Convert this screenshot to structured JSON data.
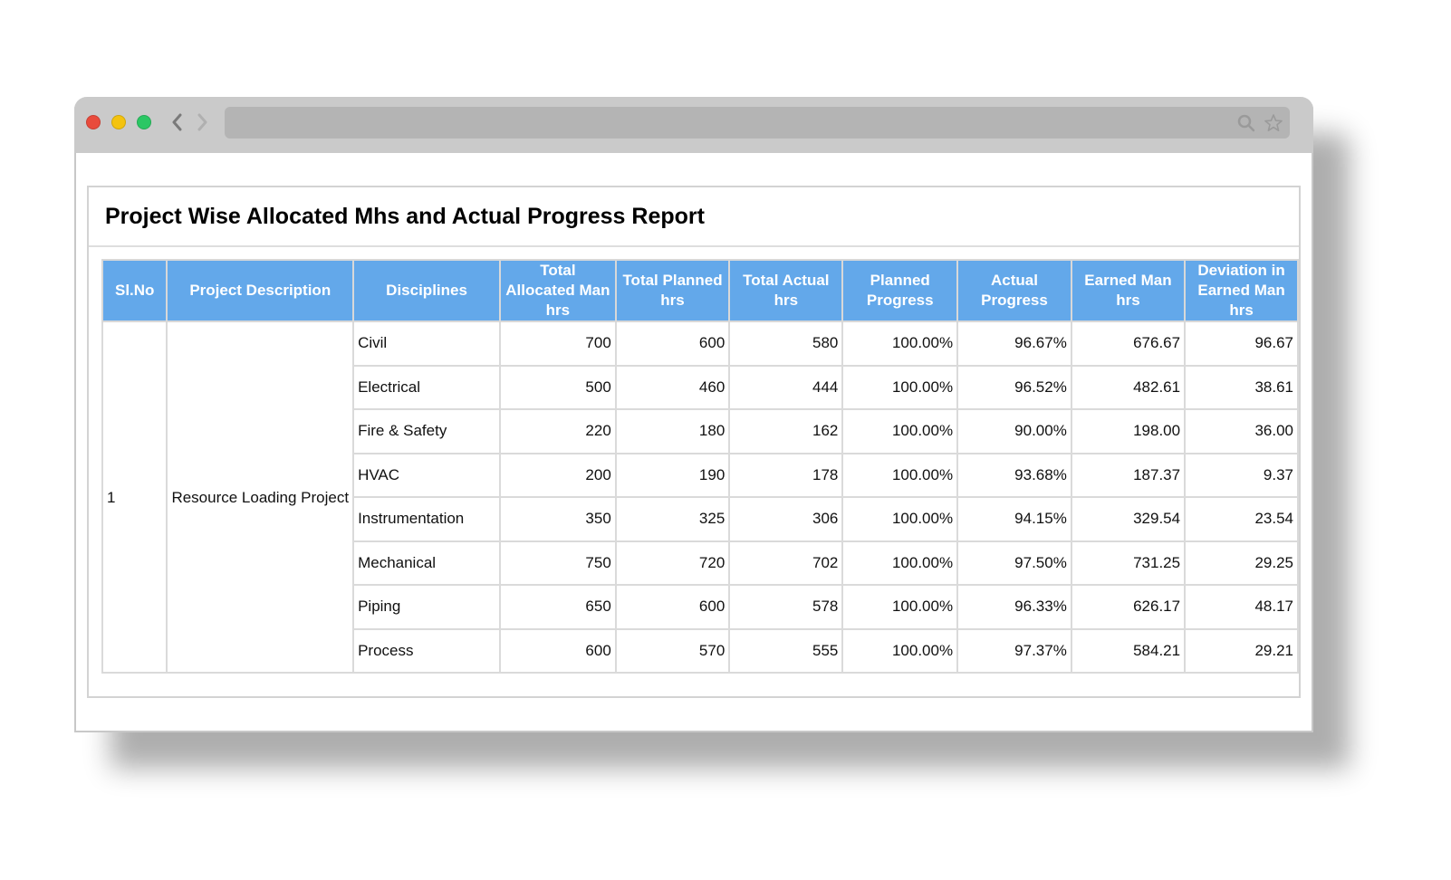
{
  "browser": {
    "url": "",
    "icons": {
      "back": "chevron-left-icon",
      "forward": "chevron-right-icon",
      "search": "search-icon",
      "bookmark": "star-icon"
    },
    "colors": {
      "close": "#e94b3c",
      "minimize": "#f4c30f",
      "maximize": "#2bc764"
    }
  },
  "report": {
    "title": "Project Wise Allocated Mhs and Actual Progress Report",
    "header_color": "#63a8ea",
    "columns": [
      "Sl.No",
      "Project Description",
      "Disciplines",
      "Total Allocated Man hrs",
      "Total Planned hrs",
      "Total Actual hrs",
      "Planned Progress",
      "Actual Progress",
      "Earned Man hrs",
      "Deviation in Earned Man hrs"
    ],
    "project": {
      "sl_no": "1",
      "description": "Resource Loading Project"
    },
    "rows": [
      {
        "discipline": "Civil",
        "allocated": "700",
        "planned": "600",
        "actual": "580",
        "planned_progress": "100.00%",
        "actual_progress": "96.67%",
        "earned": "676.67",
        "deviation": "96.67"
      },
      {
        "discipline": "Electrical",
        "allocated": "500",
        "planned": "460",
        "actual": "444",
        "planned_progress": "100.00%",
        "actual_progress": "96.52%",
        "earned": "482.61",
        "deviation": "38.61"
      },
      {
        "discipline": "Fire & Safety",
        "allocated": "220",
        "planned": "180",
        "actual": "162",
        "planned_progress": "100.00%",
        "actual_progress": "90.00%",
        "earned": "198.00",
        "deviation": "36.00"
      },
      {
        "discipline": "HVAC",
        "allocated": "200",
        "planned": "190",
        "actual": "178",
        "planned_progress": "100.00%",
        "actual_progress": "93.68%",
        "earned": "187.37",
        "deviation": "9.37"
      },
      {
        "discipline": "Instrumentation",
        "allocated": "350",
        "planned": "325",
        "actual": "306",
        "planned_progress": "100.00%",
        "actual_progress": "94.15%",
        "earned": "329.54",
        "deviation": "23.54"
      },
      {
        "discipline": "Mechanical",
        "allocated": "750",
        "planned": "720",
        "actual": "702",
        "planned_progress": "100.00%",
        "actual_progress": "97.50%",
        "earned": "731.25",
        "deviation": "29.25"
      },
      {
        "discipline": "Piping",
        "allocated": "650",
        "planned": "600",
        "actual": "578",
        "planned_progress": "100.00%",
        "actual_progress": "96.33%",
        "earned": "626.17",
        "deviation": "48.17"
      },
      {
        "discipline": "Process",
        "allocated": "600",
        "planned": "570",
        "actual": "555",
        "planned_progress": "100.00%",
        "actual_progress": "97.37%",
        "earned": "584.21",
        "deviation": "29.21"
      }
    ]
  }
}
